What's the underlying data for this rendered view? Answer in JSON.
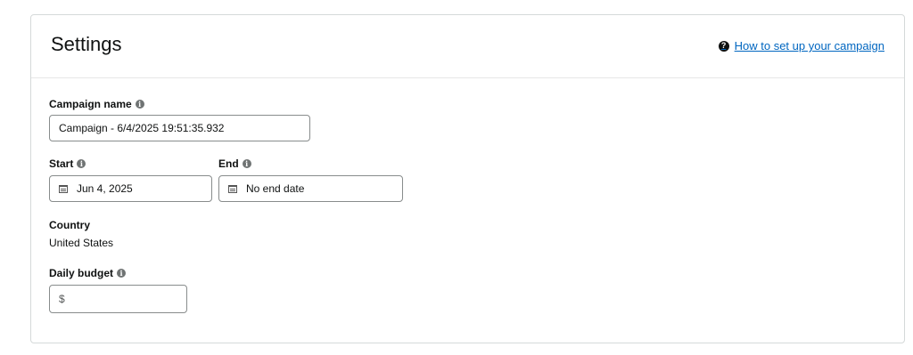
{
  "settings": {
    "title": "Settings",
    "help_link_label": "How to set up your campaign",
    "help_icon": "question-circle-icon"
  },
  "campaign_name": {
    "label": "Campaign name",
    "value": "Campaign - 6/4/2025 19:51:35.932"
  },
  "start": {
    "label": "Start",
    "value": "Jun 4, 2025"
  },
  "end": {
    "label": "End",
    "value": "No end date"
  },
  "country": {
    "label": "Country",
    "value": "United States"
  },
  "daily_budget": {
    "label": "Daily budget",
    "currency_symbol": "$",
    "value": ""
  },
  "icons": {
    "info": "info-icon",
    "calendar": "calendar-icon"
  }
}
